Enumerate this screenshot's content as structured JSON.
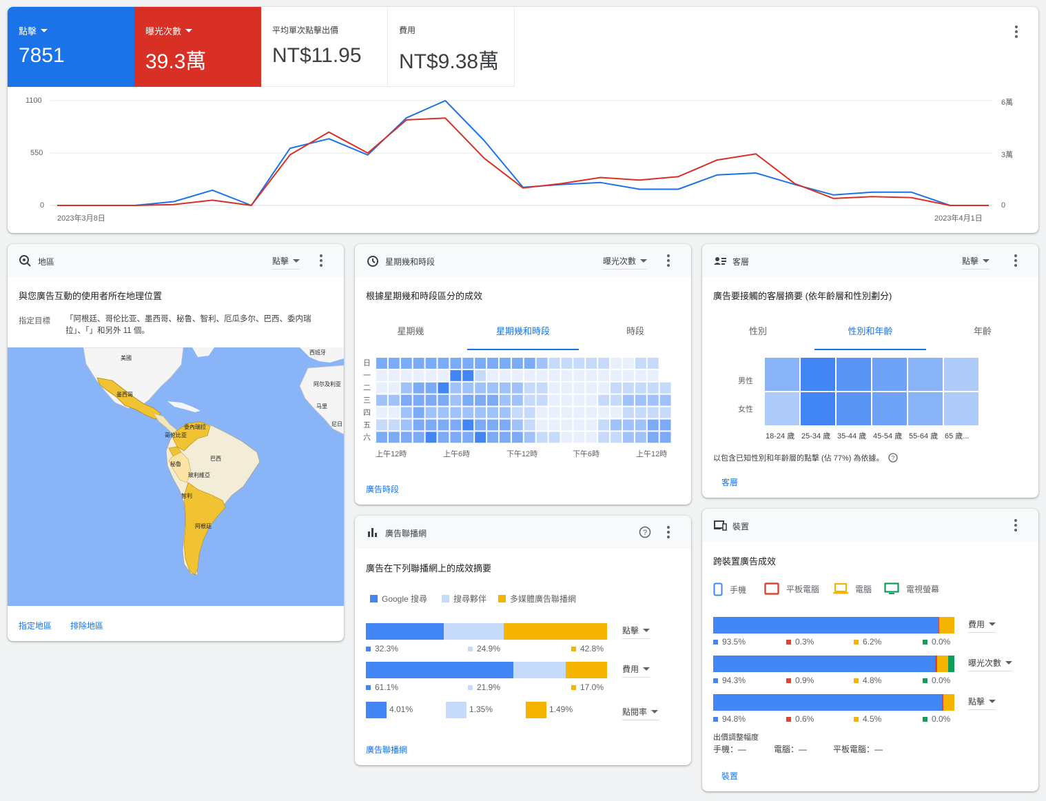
{
  "summary": {
    "metrics": [
      {
        "label": "點擊",
        "value": "7851",
        "color": "#1a73e8",
        "dropdown": true
      },
      {
        "label": "曝光次數",
        "value": "39.3萬",
        "color": "#d93025",
        "dropdown": true
      },
      {
        "label": "平均單次點擊出價",
        "value": "NT$11.95",
        "color": "#ffffff",
        "dropdown": false
      },
      {
        "label": "費用",
        "value": "NT$9.38萬",
        "color": "#ffffff",
        "dropdown": false
      }
    ]
  },
  "chart_data": {
    "type": "line",
    "x_labels": [
      "2023年3月8日",
      "2023年4月1日"
    ],
    "y_left_ticks": [
      "0",
      "550",
      "1100"
    ],
    "y_right_ticks": [
      "0",
      "3萬",
      "6萬"
    ],
    "ylim_left": [
      0,
      1100
    ],
    "ylim_right": [
      0,
      60000
    ],
    "series": [
      {
        "name": "點擊",
        "axis": "left",
        "color": "#1a73e8",
        "values": [
          0,
          0,
          0,
          40,
          160,
          0,
          600,
          700,
          530,
          920,
          1100,
          680,
          190,
          220,
          240,
          170,
          170,
          320,
          340,
          220,
          110,
          140,
          140,
          0,
          0
        ]
      },
      {
        "name": "曝光次數",
        "axis": "right",
        "color": "#d93025",
        "values": [
          0,
          0,
          0,
          500,
          3000,
          0,
          29000,
          42000,
          30000,
          49000,
          50000,
          27000,
          10000,
          12500,
          16000,
          14500,
          16500,
          26000,
          29500,
          12500,
          4000,
          5000,
          4500,
          0,
          0
        ]
      }
    ]
  },
  "region": {
    "title": "地區",
    "dropdown": "點擊",
    "subtitle": "與您廣告互動的使用者所在地理位置",
    "target_label": "指定目標",
    "target_value": "「阿根廷、哥伦比亚、墨西哥、秘鲁、智利、厄瓜多尔、巴西、委内瑞拉」、「」和另外 11 個。",
    "map_labels": {
      "usa": "美國",
      "spain": "西班牙",
      "algeria": "阿尔及利亚",
      "mali": "马里",
      "niger": "尼日",
      "mexico": "墨西哥",
      "venezuela": "委內瑞拉",
      "colombia": "哥伦比亚",
      "peru": "秘魯",
      "brazil": "巴西",
      "bolivia": "玻利維亞",
      "chile": "智利",
      "argentina": "阿根廷"
    },
    "link_targeted": "指定地區",
    "link_excluded": "排除地區"
  },
  "dayparts": {
    "title": "星期幾和時段",
    "dropdown": "曝光次數",
    "subtitle": "根據星期幾和時段區分的成效",
    "tabs": [
      "星期幾",
      "星期幾和時段",
      "時段"
    ],
    "active_tab": 1,
    "days": [
      "日",
      "一",
      "二",
      "三",
      "四",
      "五",
      "六"
    ],
    "hour_labels": [
      "上午12時",
      "上午6時",
      "下午12時",
      "下午6時",
      "上午12時"
    ],
    "heat": [
      [
        4,
        4,
        4,
        4,
        4,
        4,
        4,
        4,
        4,
        4,
        4,
        4,
        4,
        3,
        2,
        2,
        2,
        2,
        2,
        1,
        1,
        2,
        2,
        0
      ],
      [
        1,
        1,
        1,
        1,
        1,
        1,
        5,
        5,
        2,
        1,
        1,
        1,
        1,
        1,
        1,
        1,
        1,
        1,
        1,
        1,
        1,
        1,
        1,
        0
      ],
      [
        1,
        1,
        3,
        4,
        4,
        5,
        3,
        3,
        3,
        3,
        3,
        3,
        2,
        2,
        1,
        1,
        1,
        1,
        1,
        2,
        2,
        2,
        2,
        2
      ],
      [
        3,
        3,
        4,
        4,
        4,
        4,
        3,
        4,
        4,
        4,
        3,
        3,
        2,
        2,
        1,
        1,
        1,
        1,
        2,
        2,
        3,
        3,
        3,
        3
      ],
      [
        1,
        1,
        3,
        4,
        3,
        3,
        3,
        3,
        3,
        3,
        3,
        2,
        2,
        1,
        1,
        1,
        1,
        1,
        1,
        1,
        2,
        2,
        2,
        2
      ],
      [
        2,
        2,
        3,
        4,
        4,
        4,
        4,
        5,
        4,
        4,
        4,
        3,
        2,
        1,
        1,
        1,
        1,
        1,
        2,
        3,
        3,
        3,
        4,
        4
      ],
      [
        4,
        4,
        4,
        4,
        5,
        4,
        4,
        4,
        5,
        4,
        4,
        4,
        3,
        2,
        2,
        1,
        1,
        1,
        2,
        2,
        3,
        3,
        4,
        4
      ]
    ],
    "link": "廣告時段"
  },
  "audience": {
    "title": "客層",
    "dropdown": "點擊",
    "subtitle": "廣告要接觸的客層摘要 (依年齡層和性別劃分)",
    "tabs": [
      "性別",
      "性別和年齡",
      "年齡"
    ],
    "active_tab": 1,
    "rows": [
      "男性",
      "女性"
    ],
    "age_labels": [
      "18-24 歲",
      "25-34 歲",
      "35-44 歲",
      "45-54 歲",
      "55-64 歲",
      "65 歲..."
    ],
    "heat": [
      [
        2,
        5,
        4,
        3,
        2,
        1
      ],
      [
        1,
        5,
        4,
        3,
        2,
        1
      ]
    ],
    "note": "以包含已知性別和年齡層的點擊 (佔 77%) 為依據。",
    "link": "客層"
  },
  "networks": {
    "title": "廣告聯播網",
    "subtitle": "廣告在下列聯播網上的成效摘要",
    "legend": [
      {
        "label": "Google 搜尋",
        "color": "#4285f4"
      },
      {
        "label": "搜尋夥伴",
        "color": "#c6dafc"
      },
      {
        "label": "多媒體廣告聯播網",
        "color": "#f4b400"
      }
    ],
    "rows": [
      {
        "metric": "點擊",
        "values": [
          32.3,
          24.9,
          42.8
        ],
        "labels": [
          "32.3%",
          "24.9%",
          "42.8%"
        ]
      },
      {
        "metric": "費用",
        "values": [
          61.1,
          21.9,
          17.0
        ],
        "labels": [
          "61.1%",
          "21.9%",
          "17.0%"
        ]
      }
    ],
    "ctr_row": {
      "metric": "點閱率",
      "labels": [
        "4.01%",
        "1.35%",
        "1.49%"
      ]
    },
    "link": "廣告聯播網"
  },
  "devices": {
    "title": "裝置",
    "subtitle": "跨裝置廣告成效",
    "legend": [
      {
        "label": "手機",
        "color": "#4285f4",
        "icon": "phone-icon"
      },
      {
        "label": "平板電腦",
        "color": "#db4437",
        "icon": "tablet-icon"
      },
      {
        "label": "電腦",
        "color": "#f4b400",
        "icon": "computer-icon"
      },
      {
        "label": "電視螢幕",
        "color": "#0f9d58",
        "icon": "tv-icon"
      }
    ],
    "rows": [
      {
        "metric": "費用",
        "values": [
          93.5,
          0.3,
          6.2,
          0.0
        ],
        "labels": [
          "93.5%",
          "0.3%",
          "6.2%",
          "0.0%"
        ]
      },
      {
        "metric": "曝光次數",
        "values": [
          94.3,
          0.9,
          4.8,
          0.0
        ],
        "tv_visible": 2.5,
        "labels": [
          "94.3%",
          "0.9%",
          "4.8%",
          "0.0%"
        ]
      },
      {
        "metric": "點擊",
        "values": [
          94.8,
          0.6,
          4.5,
          0.0
        ],
        "labels": [
          "94.8%",
          "0.6%",
          "4.5%",
          "0.0%"
        ]
      }
    ],
    "bid_adj_title": "出價調整幅度",
    "bid_adj": [
      {
        "label": "手機：—"
      },
      {
        "label": "電腦：—"
      },
      {
        "label": "平板電腦：—"
      }
    ],
    "link": "裝置"
  }
}
